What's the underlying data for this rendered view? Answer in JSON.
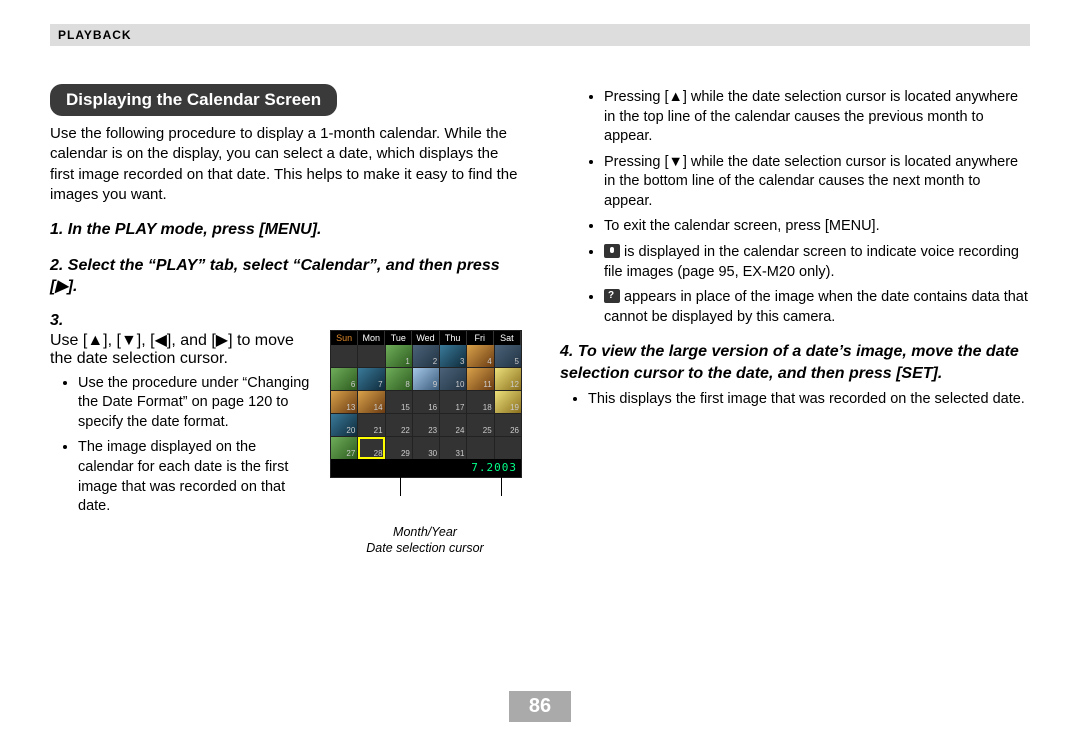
{
  "header": {
    "section_label": "PLAYBACK"
  },
  "section_title": "Displaying the Calendar Screen",
  "intro": "Use the following procedure to display a 1-month calendar. While the calendar is on the display, you can select a date, which displays the first image recorded on that date. This helps to make it easy to find the images you want.",
  "steps": {
    "s1": "In the PLAY mode, press [MENU].",
    "s2": "Select the “PLAY” tab, select “Calendar”, and then press [▶].",
    "s3": "Use [▲], [▼], [◀], and [▶] to move the date selection cursor.",
    "s4": "To view the large version of a date’s image, move the date selection cursor to the date, and then press [SET]."
  },
  "step3_bullets": [
    "Use the procedure under “Changing the Date Format” on page 120 to specify the date format.",
    "The image displayed on the calendar for each date is the first image that was recorded on that date."
  ],
  "col2_bullets_a": [
    "Pressing [▲] while the date selection cursor is located anywhere in the top line of the calendar causes the previous month to appear.",
    "Pressing [▼] while the date selection cursor is located anywhere in the bottom line of the calendar causes the next month to appear.",
    "To exit the calendar screen, press [MENU].",
    "__MIC__ is displayed in the calendar screen to indicate voice recording file images (page 95, EX-M20 only).",
    "__Q__ appears in place of the image when the date contains data that cannot be displayed by this camera."
  ],
  "step4_bullets": [
    "This displays the first image that was recorded on the selected date."
  ],
  "calendar": {
    "days": [
      "Sun",
      "Mon",
      "Tue",
      "Wed",
      "Thu",
      "Fri",
      "Sat"
    ],
    "footer": "7.2003",
    "annot_month": "Month/Year",
    "annot_cursor": "Date selection cursor",
    "cells": [
      {
        "n": "",
        "cls": "c-blank"
      },
      {
        "n": "",
        "cls": "c-blank"
      },
      {
        "n": "1",
        "cls": "c-a"
      },
      {
        "n": "2",
        "cls": "c-b"
      },
      {
        "n": "3",
        "cls": "c-d"
      },
      {
        "n": "4",
        "cls": "c-c"
      },
      {
        "n": "5",
        "cls": "c-b"
      },
      {
        "n": "6",
        "cls": "c-a"
      },
      {
        "n": "7",
        "cls": "c-d"
      },
      {
        "n": "8",
        "cls": "c-a"
      },
      {
        "n": "9",
        "cls": "c-f"
      },
      {
        "n": "10",
        "cls": "c-b"
      },
      {
        "n": "11",
        "cls": "c-c"
      },
      {
        "n": "12",
        "cls": "c-e"
      },
      {
        "n": "13",
        "cls": "c-c"
      },
      {
        "n": "14",
        "cls": "c-c"
      },
      {
        "n": "15",
        "cls": "c-blank"
      },
      {
        "n": "16",
        "cls": "c-blank"
      },
      {
        "n": "17",
        "cls": "c-blank"
      },
      {
        "n": "18",
        "cls": "c-blank"
      },
      {
        "n": "19",
        "cls": "c-e"
      },
      {
        "n": "20",
        "cls": "c-d"
      },
      {
        "n": "21",
        "cls": "c-blank"
      },
      {
        "n": "22",
        "cls": "c-blank"
      },
      {
        "n": "23",
        "cls": "c-blank"
      },
      {
        "n": "24",
        "cls": "c-blank"
      },
      {
        "n": "25",
        "cls": "c-blank"
      },
      {
        "n": "26",
        "cls": "c-blank"
      },
      {
        "n": "27",
        "cls": "c-a"
      },
      {
        "n": "28",
        "cls": "c-blank",
        "sel": true
      },
      {
        "n": "29",
        "cls": "c-blank"
      },
      {
        "n": "30",
        "cls": "c-blank"
      },
      {
        "n": "31",
        "cls": "c-blank"
      },
      {
        "n": "",
        "cls": "c-blank"
      },
      {
        "n": "",
        "cls": "c-blank"
      }
    ]
  },
  "page_number": "86"
}
